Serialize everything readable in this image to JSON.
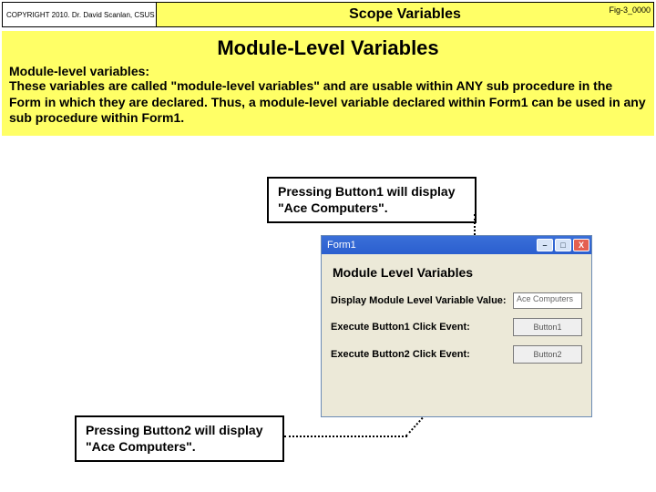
{
  "header": {
    "copyright": "COPYRIGHT 2010. Dr. David Scanlan, CSUS",
    "title": "Scope Variables",
    "fig_id": "Fig-3_0000"
  },
  "content": {
    "subheading": "Module-Level Variables",
    "para_lead": "Module-level variables:",
    "para_body": "These variables are called \"module-level variables\" and are usable within ANY sub procedure in the Form in which they are declared.  Thus,  a module-level variable declared within Form1 can be  used in any sub procedure within Form1."
  },
  "callouts": {
    "c1": "Pressing  Button1 will display \"Ace Computers\".",
    "c2": "Pressing  Button2 will display \"Ace Computers\"."
  },
  "window": {
    "title": "Form1",
    "min_glyph": "–",
    "max_glyph": "□",
    "close_glyph": "X",
    "heading": "Module Level Variables",
    "row1_label": "Display Module Level Variable Value:",
    "row1_value": "Ace Computers",
    "row2_label": "Execute Button1 Click Event:",
    "row2_btn": "Button1",
    "row3_label": "Execute Button2 Click Event:",
    "row3_btn": "Button2"
  }
}
